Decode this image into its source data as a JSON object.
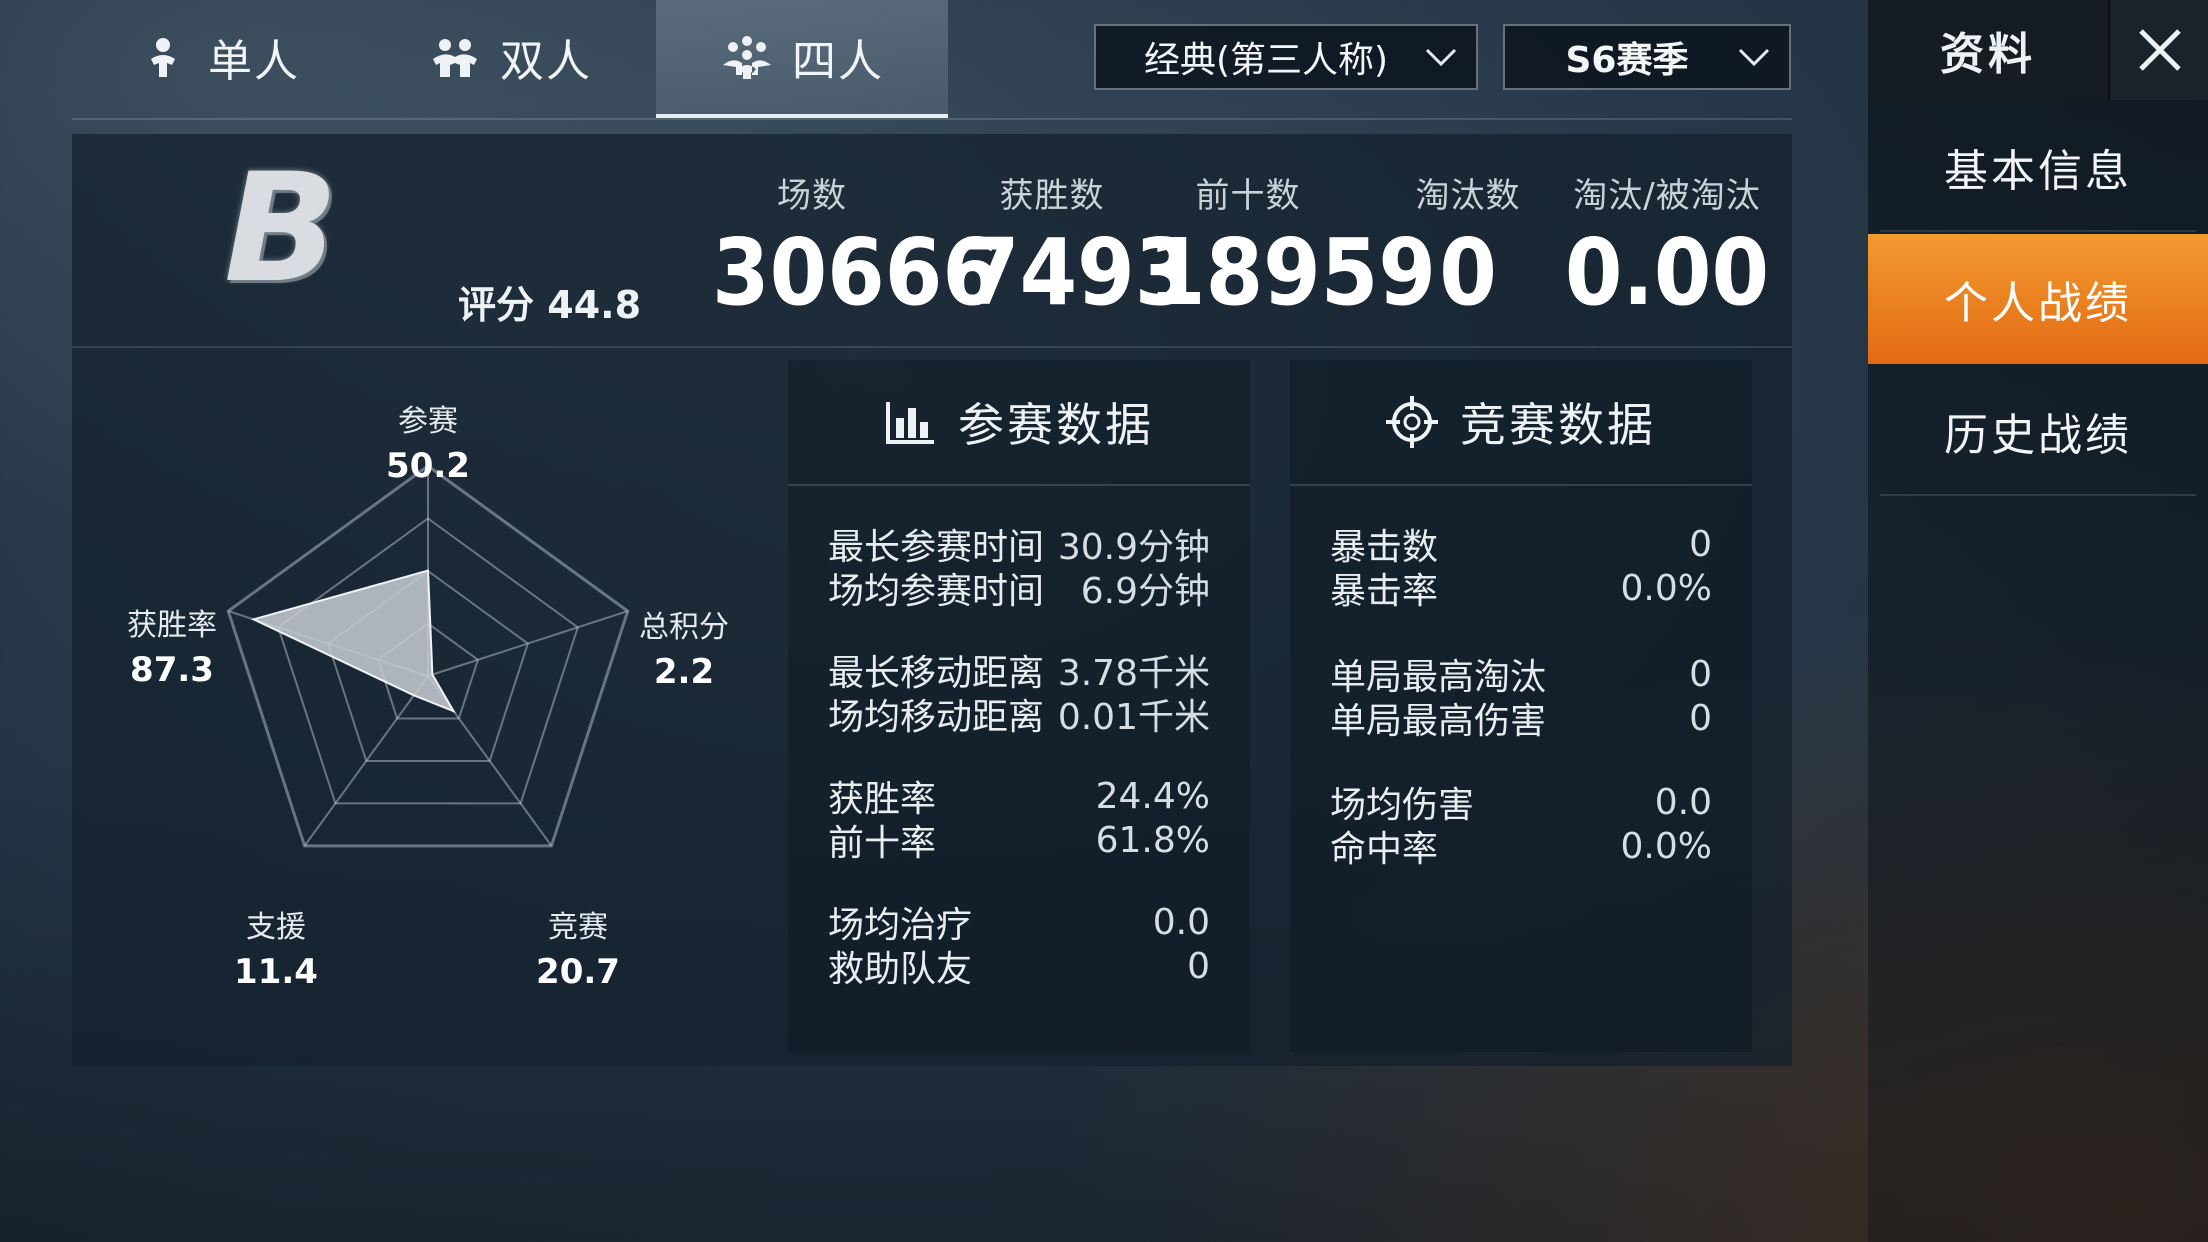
{
  "mode_tabs": [
    {
      "label": "单人",
      "icon": "single-player-icon",
      "active": false
    },
    {
      "label": "双人",
      "icon": "duo-icon",
      "active": false
    },
    {
      "label": "四人",
      "icon": "squad-icon",
      "active": true
    }
  ],
  "filters": {
    "mode_label": "经典(第三人称)",
    "season_label": "S6赛季"
  },
  "side_panel": {
    "title": "资料",
    "menu": [
      {
        "label": "基本信息",
        "active": false
      },
      {
        "label": "个人战绩",
        "active": true
      },
      {
        "label": "历史战绩",
        "active": false
      }
    ]
  },
  "summary": {
    "rank_letter": "B",
    "rating_label": "评分",
    "rating_value": "44.8",
    "stats": [
      {
        "label": "场数",
        "value": "30666"
      },
      {
        "label": "获胜数",
        "value": "7493"
      },
      {
        "label": "前十数",
        "value": "18959"
      },
      {
        "label": "淘汰数",
        "value": "0"
      },
      {
        "label": "淘汰/被淘汰",
        "value": "0.00"
      }
    ]
  },
  "radar": {
    "axes": [
      {
        "label": "参赛",
        "value": "50.2"
      },
      {
        "label": "总积分",
        "value": "2.2"
      },
      {
        "label": "竞赛",
        "value": "20.7"
      },
      {
        "label": "支援",
        "value": "11.4"
      },
      {
        "label": "获胜率",
        "value": "87.3"
      }
    ],
    "values": [
      50.2,
      2.2,
      20.7,
      11.4,
      87.3
    ],
    "max": 100,
    "rings": 4
  },
  "participation": {
    "title": "参赛数据",
    "rows": [
      {
        "label": "最长参赛时间",
        "value": "30.9分钟"
      },
      {
        "label": "场均参赛时间",
        "value": "6.9分钟"
      },
      {
        "label": "最长移动距离",
        "value": "3.78千米"
      },
      {
        "label": "场均移动距离",
        "value": "0.01千米"
      },
      {
        "label": "获胜率",
        "value": "24.4%"
      },
      {
        "label": "前十率",
        "value": "61.8%"
      },
      {
        "label": "场均治疗",
        "value": "0.0"
      },
      {
        "label": "救助队友",
        "value": "0"
      }
    ]
  },
  "combat": {
    "title": "竞赛数据",
    "rows": [
      {
        "label": "暴击数",
        "value": "0"
      },
      {
        "label": "暴击率",
        "value": "0.0%"
      },
      {
        "label": "单局最高淘汰",
        "value": "0"
      },
      {
        "label": "单局最高伤害",
        "value": "0"
      },
      {
        "label": "场均伤害",
        "value": "0.0"
      },
      {
        "label": "命中率",
        "value": "0.0%"
      }
    ]
  }
}
